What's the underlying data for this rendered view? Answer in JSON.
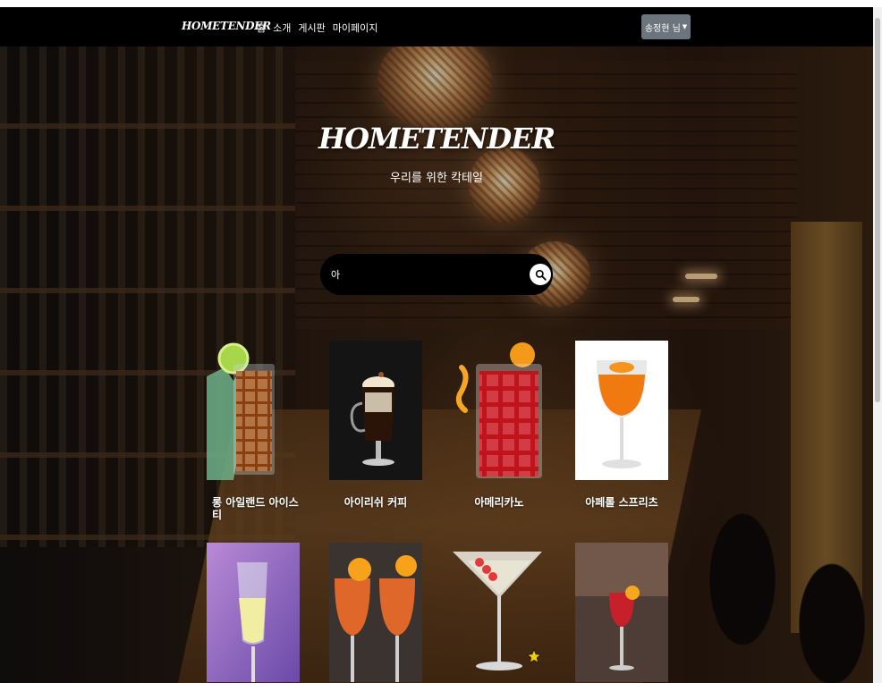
{
  "navbar": {
    "brand": "HOMETENDER",
    "links": [
      {
        "label": "홈"
      },
      {
        "label": "소개"
      },
      {
        "label": "게시판"
      },
      {
        "label": "마이페이지"
      }
    ],
    "user_button": "송정현 님"
  },
  "hero": {
    "title": "HOMETENDER",
    "subtitle": "우리를 위한 칵테일"
  },
  "search": {
    "value": "아",
    "icon": "search-icon"
  },
  "cocktails": [
    {
      "name": "롱 아일랜드 아이스 티"
    },
    {
      "name": "아이리쉬 커피"
    },
    {
      "name": "아메리카노"
    },
    {
      "name": "아페롤 스프리츠"
    },
    {
      "name": ""
    },
    {
      "name": ""
    },
    {
      "name": ""
    },
    {
      "name": ""
    }
  ],
  "colors": {
    "navbar_bg": "#000000",
    "user_button_bg": "#6c757d",
    "search_bg": "#000000",
    "favorite_star": "#f5d000"
  }
}
